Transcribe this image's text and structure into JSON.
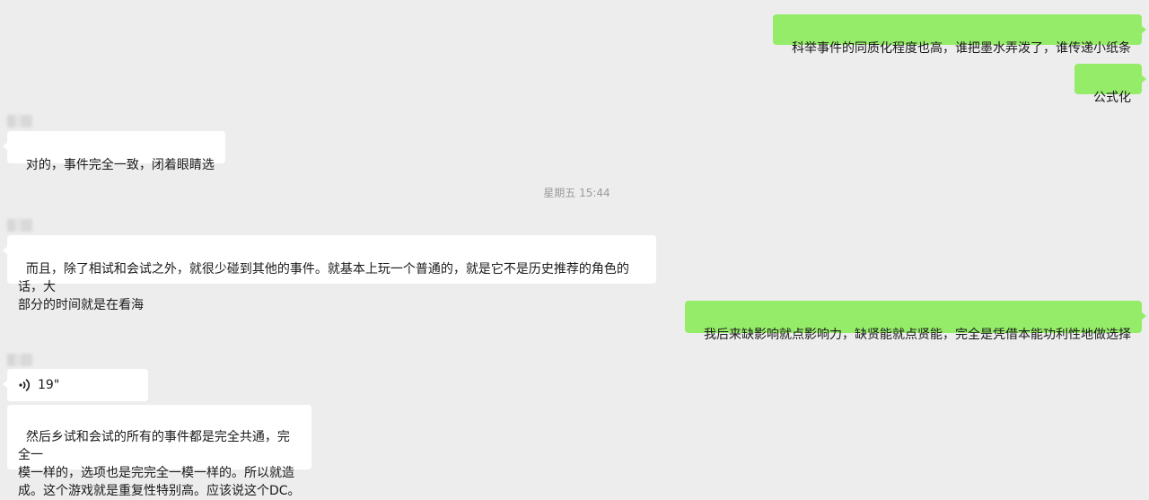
{
  "messages": [
    {
      "side": "out",
      "text": "科举事件的同质化程度也高，谁把墨水弄泼了，谁传递小纸条"
    },
    {
      "side": "out",
      "text": "公式化"
    },
    {
      "side": "in",
      "text": "对的，事件完全一致，闭着眼睛选"
    },
    {
      "side": "in",
      "text": "而且，除了相试和会试之外，就很少碰到其他的事件。就基本上玩一个普通的，就是它不是历史推荐的角色的话，大\n部分的时间就是在看海"
    },
    {
      "side": "out",
      "text": "我后来缺影响就点影响力，缺贤能就点贤能，完全是凭借本能功利性地做选择"
    },
    {
      "side": "in",
      "type": "voice",
      "duration": "19\""
    },
    {
      "side": "in",
      "text": "然后乡试和会试的所有的事件都是完全共通，完全一\n模一样的，选项也是完完全一模一样的。所以就造\n成。这个游戏就是重复性特别高。应该说这个DC。"
    }
  ],
  "timestamp": "星期五 15:44",
  "icons": {
    "voice": "voice-wave-icon"
  },
  "colors": {
    "background": "#ededed",
    "outgoing_bubble": "#95ec69",
    "incoming_bubble": "#ffffff"
  }
}
